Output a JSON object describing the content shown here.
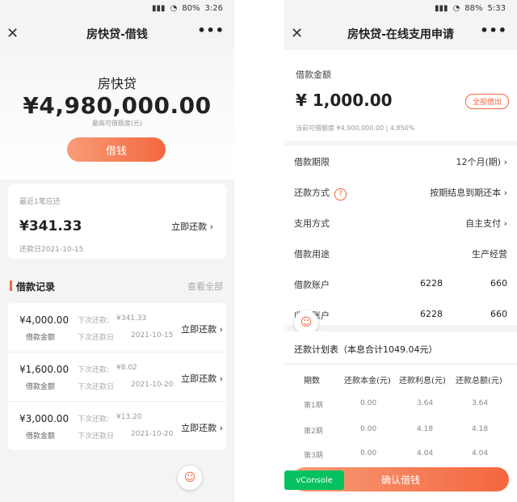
{
  "left": {
    "status": {
      "battery": "80%",
      "time": "3:26"
    },
    "title": "房快贷-借钱",
    "product_name": "房快贷",
    "max_amount": "¥4,980,000.00",
    "max_amount_caption": "最高可借额度(元)",
    "borrow_label": "借钱",
    "due": {
      "label": "最近1笔应还",
      "amount": "¥341.33",
      "repay_label": "立即还款",
      "date": "还款日2021-10-15"
    },
    "records_title": "借款记录",
    "view_all": "查看全部",
    "records": [
      {
        "amount": "¥4,000.00",
        "amount_label": "借款金额",
        "next_repay_label": "下次还款:",
        "next_repay": "¥341.33",
        "next_date_label": "下次还款日",
        "next_date": "2021-10-15",
        "action": "立即还款"
      },
      {
        "amount": "¥1,600.00",
        "amount_label": "借款金额",
        "next_repay_label": "下次还款:",
        "next_repay": "¥8.02",
        "next_date_label": "下次还款日",
        "next_date": "2021-10-20",
        "action": "立即还款"
      },
      {
        "amount": "¥3,000.00",
        "amount_label": "借款金额",
        "next_repay_label": "下次还款:",
        "next_repay": "¥13.20",
        "next_date_label": "下次还款日",
        "next_date": "2021-10-20",
        "action": "立即还款"
      }
    ]
  },
  "right": {
    "status": {
      "battery": "88%",
      "time": "5:33"
    },
    "title": "房快贷-在线支用申请",
    "amount_label": "借款金额",
    "amount": "¥ 1,000.00",
    "all_out": "全部借出",
    "available": "当前可借额度 ¥4,900,000.00 | 4.850%",
    "fields": [
      {
        "key": "借款期限",
        "value": "12个月(期)"
      },
      {
        "key": "还款方式",
        "value": "按期结息到期还本"
      },
      {
        "key": "支用方式",
        "value": "自主支付"
      },
      {
        "key": "借款用途",
        "value": "生产经营"
      },
      {
        "key": "借款账户",
        "value_a": "6228",
        "value_b": "660"
      },
      {
        "key": "收款账户",
        "value_a": "6228",
        "value_b": "660"
      }
    ],
    "plan_title": "还款计划表（本息合计1049.04元）",
    "plan_headers": [
      "期数",
      "还款本金(元)",
      "还款利息(元)",
      "还款总额(元)"
    ],
    "plan_rows": [
      [
        "第1期",
        "0.00",
        "3.64",
        "3.64"
      ],
      [
        "第2期",
        "0.00",
        "4.18",
        "4.18"
      ],
      [
        "第3期",
        "0.00",
        "4.04",
        "4.04"
      ]
    ],
    "confirm_label": "确认借钱",
    "vconsole_label": "vConsole"
  }
}
